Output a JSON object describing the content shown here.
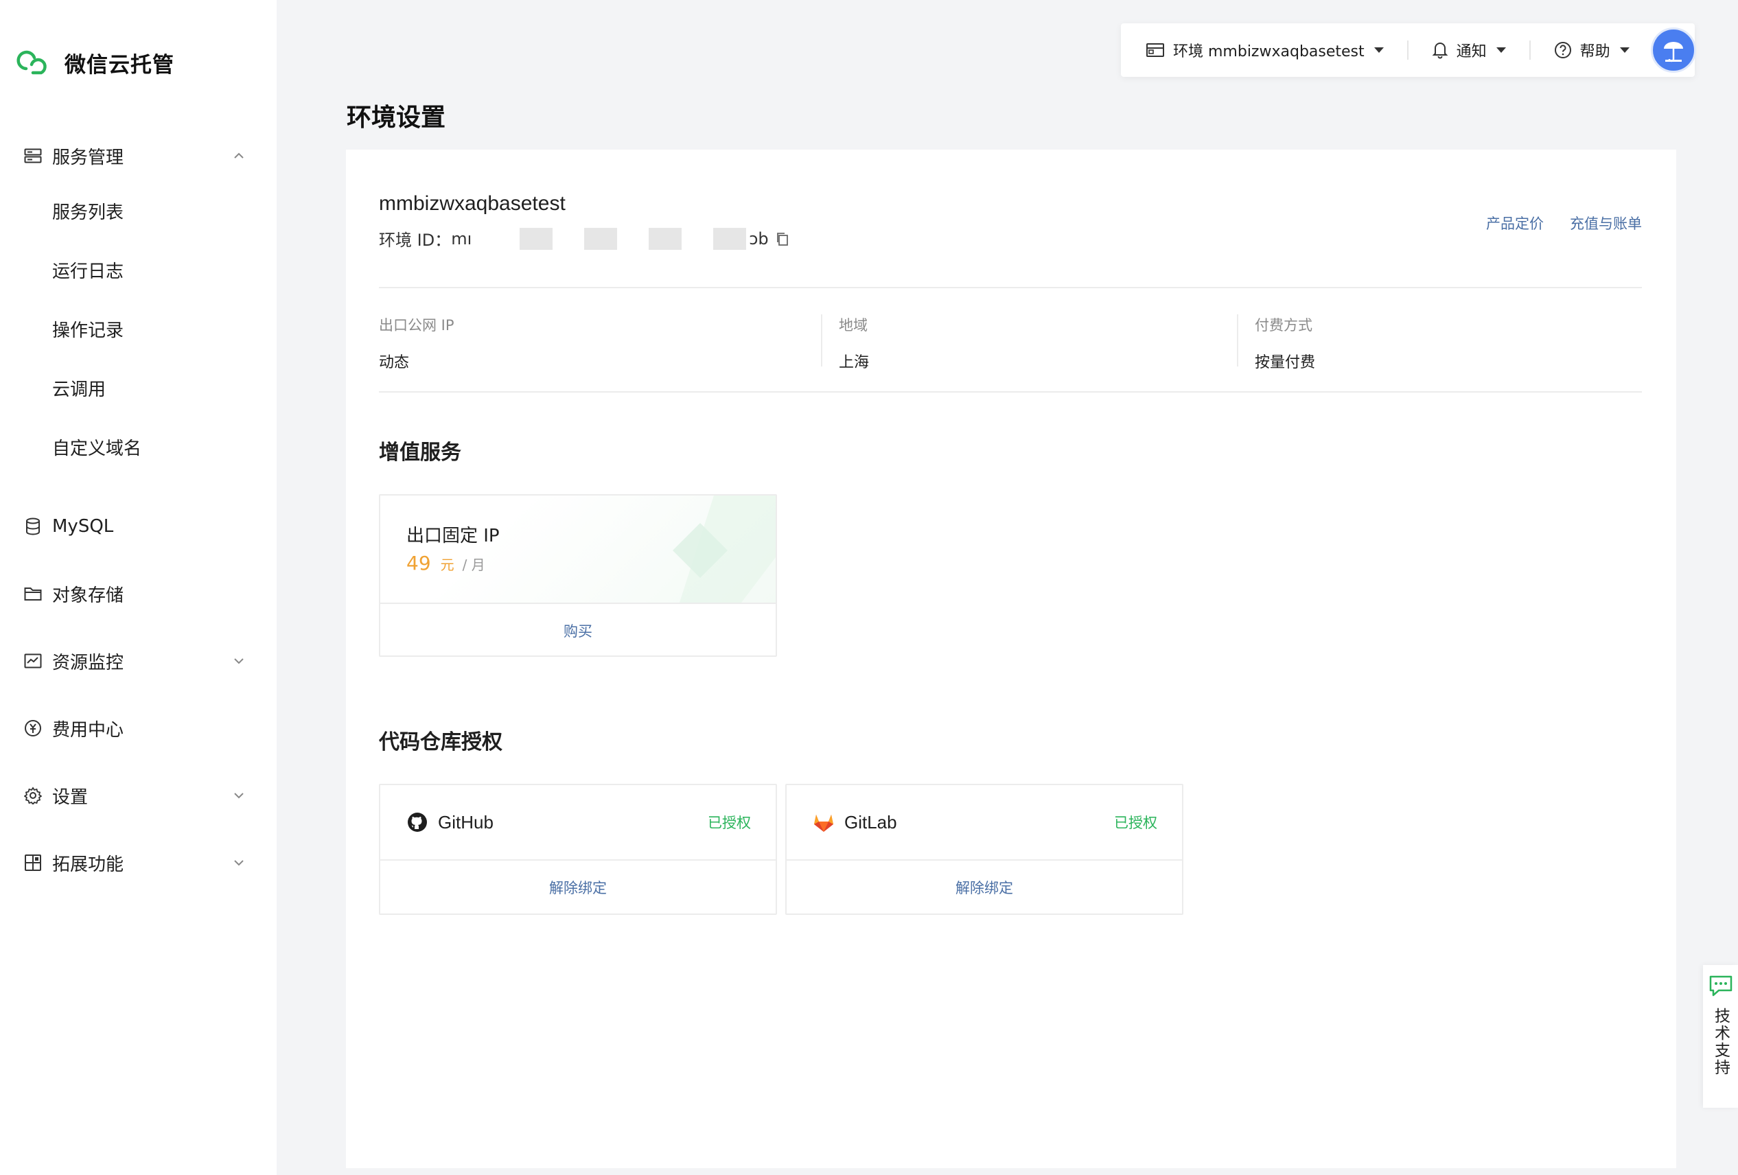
{
  "brand": {
    "name": "微信云托管"
  },
  "sidebar": {
    "groups": [
      {
        "label": "服务管理",
        "icon": "server-icon",
        "expanded": true,
        "items": [
          {
            "label": "服务列表"
          },
          {
            "label": "运行日志"
          },
          {
            "label": "操作记录"
          },
          {
            "label": "云调用"
          },
          {
            "label": "自定义域名"
          }
        ]
      },
      {
        "label": "MySQL",
        "icon": "database-icon"
      },
      {
        "label": "对象存储",
        "icon": "folder-icon"
      },
      {
        "label": "资源监控",
        "icon": "monitor-icon",
        "expanded": false
      },
      {
        "label": "费用中心",
        "icon": "yen-icon"
      },
      {
        "label": "设置",
        "icon": "gear-icon",
        "expanded": false
      },
      {
        "label": "拓展功能",
        "icon": "extension-icon",
        "expanded": false
      }
    ]
  },
  "topbar": {
    "env_label": "环境 mmbizwxaqbasetest",
    "notify_label": "通知",
    "help_label": "帮助"
  },
  "page": {
    "title": "环境设置"
  },
  "env": {
    "name": "mmbizwxaqbasetest",
    "id_label": "环境 ID：",
    "id_prefix": "mı",
    "id_suffix": "ɔb",
    "links": {
      "pricing": "产品定价",
      "billing": "充值与账单"
    },
    "info": [
      {
        "label": "出口公网 IP",
        "value": "动态"
      },
      {
        "label": "地域",
        "value": "上海"
      },
      {
        "label": "付费方式",
        "value": "按量付费"
      }
    ]
  },
  "value_added": {
    "title": "增值服务",
    "card": {
      "name": "出口固定 IP",
      "price": "49",
      "unit": "元",
      "period": "/ 月",
      "action": "购买"
    }
  },
  "repo_auth": {
    "title": "代码仓库授权",
    "repos": [
      {
        "name": "GitHub",
        "status": "已授权",
        "action": "解除绑定",
        "icon": "github-icon"
      },
      {
        "name": "GitLab",
        "status": "已授权",
        "action": "解除绑定",
        "icon": "gitlab-icon"
      }
    ]
  },
  "support": {
    "label": "技术支持"
  },
  "colors": {
    "accent_green": "#2bb45b",
    "link_blue": "#4a6fa5",
    "price_orange": "#f0a233",
    "avatar_blue": "#4a7ef0"
  }
}
